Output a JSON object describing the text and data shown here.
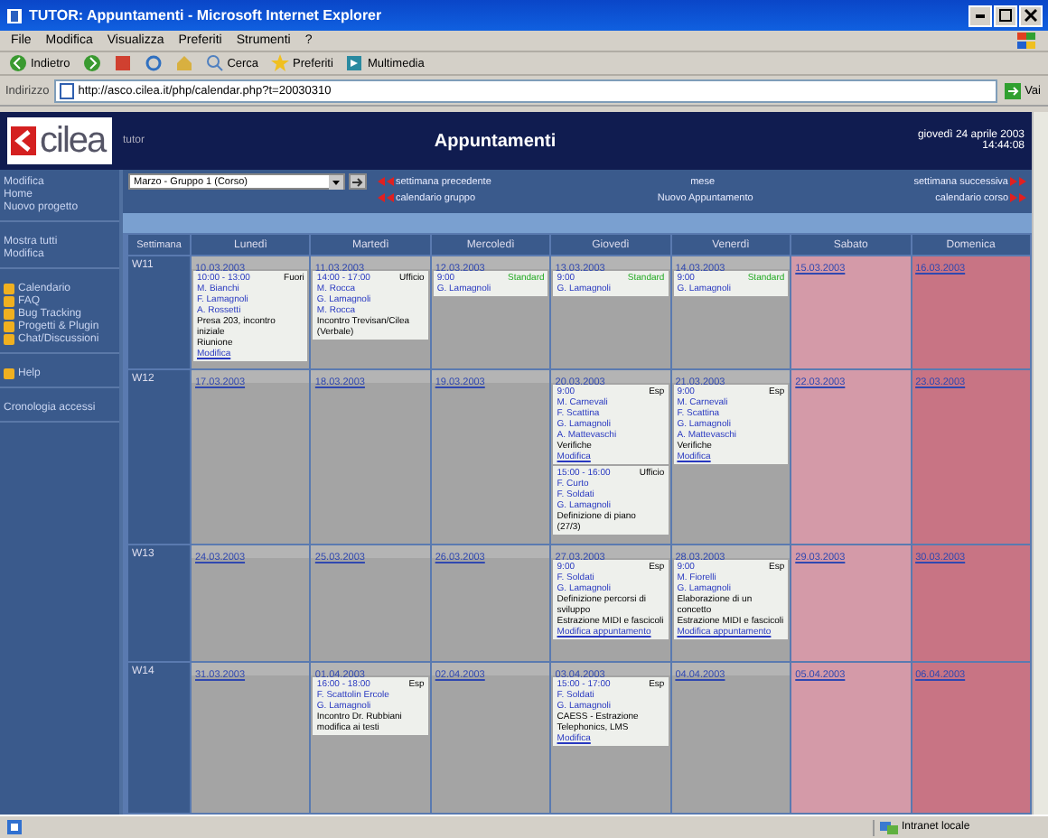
{
  "window": {
    "title": "TUTOR: Appuntamenti - Microsoft Internet Explorer"
  },
  "menu": [
    "File",
    "Modifica",
    "Visualizza",
    "Preferiti",
    "Strumenti",
    "?"
  ],
  "toolbar": [
    {
      "label": "Indietro",
      "kind": "back"
    },
    {
      "kind": "forward"
    },
    {
      "kind": "stop"
    },
    {
      "kind": "refresh"
    },
    {
      "kind": "home"
    },
    {
      "label": "Cerca",
      "kind": "search"
    },
    {
      "label": "Preferiti",
      "kind": "star"
    },
    {
      "label": "Multimedia",
      "kind": "media"
    }
  ],
  "address": {
    "label": "Indirizzo",
    "value": "http://asco.cilea.it/php/calendar.php?t=20030310",
    "go": "Vai"
  },
  "header": {
    "logo": "cilea",
    "subtitle": "tutor",
    "title": "Appuntamenti",
    "date": "giovedì 24 aprile 2003",
    "time": "14:44:08"
  },
  "nav": {
    "select": "Marzo - Gruppo 1 (Corso)",
    "rows": [
      [
        {
          "label": "settimana precedente",
          "kind": "previous"
        },
        {
          "label": "mese",
          "kind": "plain"
        },
        {
          "label": "settimana successiva",
          "kind": "next"
        }
      ],
      [
        {
          "label": "calendario gruppo",
          "kind": "previous"
        },
        {
          "label": "Nuovo Appuntamento",
          "kind": "plain"
        },
        {
          "label": "calendario corso",
          "kind": "next"
        }
      ]
    ]
  },
  "sidebar": {
    "groups": [
      [
        {
          "label": "Modifica",
          "bullet": false
        },
        {
          "label": "Home",
          "bullet": false
        },
        {
          "label": "Nuovo progetto",
          "bullet": false
        }
      ],
      [
        {
          "label": "Mostra tutti",
          "bullet": false
        },
        {
          "label": "Modifica",
          "bullet": false
        }
      ],
      [
        {
          "label": "Calendario",
          "bullet": true
        },
        {
          "label": "FAQ",
          "bullet": true
        },
        {
          "label": "Bug Tracking",
          "bullet": true
        },
        {
          "label": "Progetti & Plugin",
          "bullet": true
        },
        {
          "label": "Chat/Discussioni",
          "bullet": true
        }
      ],
      [
        {
          "label": "Help",
          "bullet": true
        }
      ],
      [
        {
          "label": "Cronologia accessi",
          "bullet": false
        }
      ]
    ]
  },
  "calendar": {
    "columns": [
      {
        "label": "Settimana",
        "kind": "week"
      },
      {
        "label": "Lunedì",
        "kind": "weekday"
      },
      {
        "label": "Martedì",
        "kind": "weekday"
      },
      {
        "label": "Mercoledì",
        "kind": "weekday"
      },
      {
        "label": "Giovedì",
        "kind": "weekday"
      },
      {
        "label": "Venerdì",
        "kind": "weekday"
      },
      {
        "label": "Sabato",
        "kind": "saturday"
      },
      {
        "label": "Domenica",
        "kind": "sunday"
      }
    ],
    "weeks": [
      {
        "label": "W11",
        "days": [
          {
            "date": "10.03.2003",
            "appointments": [
              {
                "time": "10:00 - 13:00",
                "tag": "Fuori",
                "kind": "default",
                "people": [
                  "M. Bianchi",
                  "F. Lamagnoli",
                  "A. Rossetti"
                ],
                "notes": [
                  "Presa 203, incontro iniziale",
                  "Riunione"
                ],
                "link": "Modifica"
              }
            ]
          },
          {
            "date": "11.03.2003",
            "appointments": [
              {
                "time": "14:00 - 17:00",
                "tag": "Ufficio",
                "kind": "default",
                "people": [
                  "M. Rocca",
                  "G. Lamagnoli",
                  "M. Rocca"
                ],
                "notes": [
                  "Incontro Trevisan/Cilea",
                  "(Verbale)"
                ]
              }
            ]
          },
          {
            "date": "12.03.2003",
            "appointments": [
              {
                "time": "9:00",
                "tag": "Standard",
                "kind": "standard",
                "people": [
                  "G. Lamagnoli"
                ]
              }
            ]
          },
          {
            "date": "13.03.2003",
            "appointments": [
              {
                "time": "9:00",
                "tag": "Standard",
                "kind": "standard",
                "people": [
                  "G. Lamagnoli"
                ]
              }
            ]
          },
          {
            "date": "14.03.2003",
            "appointments": [
              {
                "time": "9:00",
                "tag": "Standard",
                "kind": "standard",
                "people": [
                  "G. Lamagnoli"
                ]
              }
            ]
          },
          {
            "date": "15.03.2003"
          },
          {
            "date": "16.03.2003"
          }
        ]
      },
      {
        "label": "W12",
        "days": [
          {
            "date": "17.03.2003"
          },
          {
            "date": "18.03.2003"
          },
          {
            "date": "19.03.2003"
          },
          {
            "date": "20.03.2003",
            "appointments": [
              {
                "time": "9:00",
                "tag": "Esp",
                "kind": "default",
                "people": [
                  "M. Carnevali",
                  "F. Scattina",
                  "G. Lamagnoli",
                  "A. Mattevaschi"
                ],
                "notes": [
                  "Verifiche"
                ],
                "link": "Modifica"
              },
              {
                "time": "15:00 - 16:00",
                "tag": "Ufficio",
                "kind": "default",
                "people": [
                  "F. Curto",
                  "F. Soldati",
                  "G. Lamagnoli"
                ],
                "notes": [
                  "Definizione di piano",
                  "(27/3)"
                ]
              }
            ]
          },
          {
            "date": "21.03.2003",
            "appointments": [
              {
                "time": "9:00",
                "tag": "Esp",
                "kind": "default",
                "people": [
                  "M. Carnevali",
                  "F. Scattina",
                  "G. Lamagnoli",
                  "A. Mattevaschi"
                ],
                "notes": [
                  "Verifiche"
                ],
                "link": "Modifica"
              }
            ]
          },
          {
            "date": "22.03.2003"
          },
          {
            "date": "23.03.2003"
          }
        ]
      },
      {
        "label": "W13",
        "days": [
          {
            "date": "24.03.2003"
          },
          {
            "date": "25.03.2003"
          },
          {
            "date": "26.03.2003"
          },
          {
            "date": "27.03.2003",
            "appointments": [
              {
                "time": "9:00",
                "tag": "Esp",
                "kind": "default",
                "people": [
                  "F. Soldati",
                  "G. Lamagnoli"
                ],
                "notes": [
                  "Definizione percorsi di sviluppo",
                  "Estrazione MIDI e fascicoli"
                ],
                "link": "Modifica appuntamento"
              }
            ]
          },
          {
            "date": "28.03.2003",
            "appointments": [
              {
                "time": "9:00",
                "tag": "Esp",
                "kind": "default",
                "people": [
                  "M. Fiorelli",
                  "G. Lamagnoli"
                ],
                "notes": [
                  "Elaborazione di un concetto",
                  "Estrazione MIDI e fascicoli"
                ],
                "link": "Modifica appuntamento"
              }
            ]
          },
          {
            "date": "29.03.2003"
          },
          {
            "date": "30.03.2003"
          }
        ]
      },
      {
        "label": "W14",
        "days": [
          {
            "date": "31.03.2003"
          },
          {
            "date": "01.04.2003",
            "appointments": [
              {
                "time": "16:00 - 18:00",
                "tag": "Esp",
                "kind": "default",
                "people": [
                  "F. Scattolin Ercole",
                  "G. Lamagnoli"
                ],
                "notes": [
                  "Incontro Dr. Rubbiani",
                  "modifica ai testi"
                ]
              }
            ]
          },
          {
            "date": "02.04.2003"
          },
          {
            "date": "03.04.2003",
            "appointments": [
              {
                "time": "15:00 - 17:00",
                "tag": "Esp",
                "kind": "default",
                "people": [
                  "F. Soldati",
                  "G. Lamagnoli"
                ],
                "notes": [
                  "CAESS - Estrazione Telephonics, LMS"
                ],
                "link": "Modifica"
              }
            ]
          },
          {
            "date": "04.04.2003"
          },
          {
            "date": "05.04.2003"
          },
          {
            "date": "06.04.2003"
          }
        ]
      }
    ]
  },
  "status_bar": {
    "zone": "Intranet locale"
  }
}
